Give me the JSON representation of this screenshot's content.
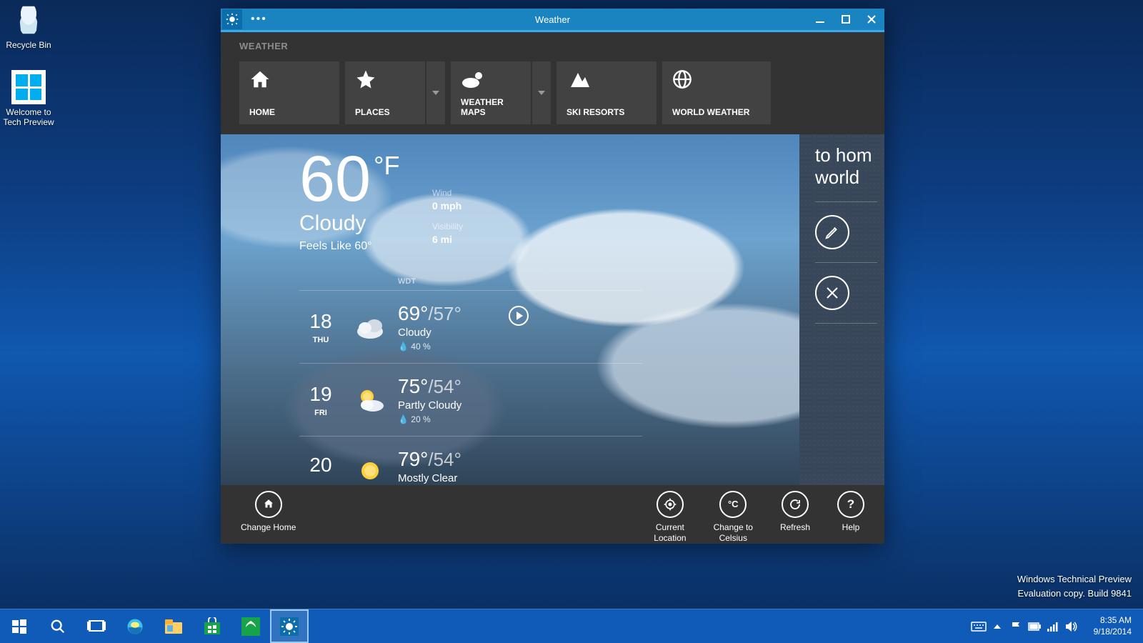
{
  "desktop": {
    "recycle_bin": "Recycle Bin",
    "tech_preview": "Welcome to\nTech Preview"
  },
  "watermark": {
    "line1": "Windows Technical Preview",
    "line2": "Evaluation copy. Build 9841"
  },
  "taskbar": {
    "time": "8:35 AM",
    "date": "9/18/2014"
  },
  "window": {
    "title": "Weather",
    "nav": {
      "section": "WEATHER",
      "tiles": [
        {
          "label": "HOME"
        },
        {
          "label": "PLACES"
        },
        {
          "label": "WEATHER MAPS"
        },
        {
          "label": "SKI RESORTS"
        },
        {
          "label": "WORLD WEATHER"
        }
      ]
    },
    "current": {
      "temp": "60",
      "unit": "°F",
      "cond": "Cloudy",
      "feels": "Feels Like 60°",
      "wind_label": "Wind",
      "wind_val": "0 mph",
      "vis_label": "Visibility",
      "vis_val": "6 mi"
    },
    "provider": "WDT",
    "forecast": [
      {
        "num": "18",
        "dow": "THU",
        "hi": "69°",
        "lo": "/57°",
        "desc": "Cloudy",
        "precip": "40 %"
      },
      {
        "num": "19",
        "dow": "FRI",
        "hi": "75°",
        "lo": "/54°",
        "desc": "Partly Cloudy",
        "precip": "20 %"
      },
      {
        "num": "20",
        "dow": "",
        "hi": "79°",
        "lo": "/54°",
        "desc": "Mostly Clear",
        "precip": ""
      }
    ],
    "side": {
      "line1": "to hom",
      "line2": "world"
    },
    "appbar": {
      "change_home": "Change Home",
      "current_loc": "Current\nLocation",
      "celsius": "Change to\nCelsius",
      "refresh": "Refresh",
      "help": "Help"
    }
  }
}
